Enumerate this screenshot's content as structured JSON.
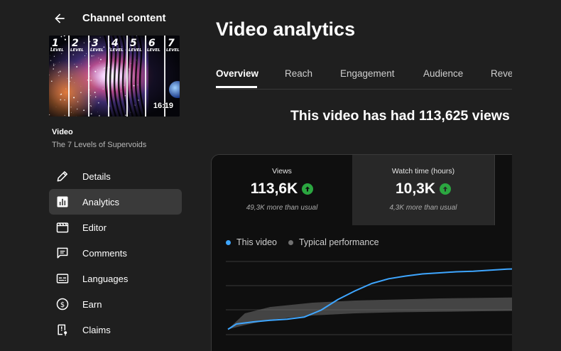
{
  "header": {
    "back_label": "Channel content"
  },
  "video": {
    "thumbnail_levels": [
      "1",
      "2",
      "3",
      "4",
      "5",
      "6",
      "7"
    ],
    "thumbnail_word": "LEVEL",
    "duration": "16:19",
    "label": "Video",
    "title": "The 7 Levels of Supervoids"
  },
  "sidebar": {
    "items": [
      {
        "label": "Details",
        "icon": "pencil-icon"
      },
      {
        "label": "Analytics",
        "icon": "analytics-icon",
        "active": true
      },
      {
        "label": "Editor",
        "icon": "clapperboard-icon"
      },
      {
        "label": "Comments",
        "icon": "comment-icon"
      },
      {
        "label": "Languages",
        "icon": "subtitles-icon"
      },
      {
        "label": "Earn",
        "icon": "dollar-icon"
      },
      {
        "label": "Claims",
        "icon": "copyright-claim-icon"
      }
    ]
  },
  "main": {
    "title": "Video analytics",
    "tabs": [
      "Overview",
      "Reach",
      "Engagement",
      "Audience",
      "Revenue"
    ],
    "headline": "This video has had 113,625 views",
    "metrics": [
      {
        "label": "Views",
        "value": "113,6K",
        "sub": "49,3K more than usual"
      },
      {
        "label": "Watch time (hours)",
        "value": "10,3K",
        "sub": "4,3K more than usual"
      }
    ],
    "legend": [
      {
        "label": "This video",
        "color": "#3ea6ff"
      },
      {
        "label": "Typical performance",
        "color": "#717171"
      }
    ]
  },
  "chart_data": {
    "type": "line",
    "x_ticks": [
      "0",
      "10",
      "20",
      "30"
    ],
    "xlim": [
      0,
      35
    ],
    "series": [
      {
        "name": "This video",
        "color": "#3ea6ff",
        "x": [
          0,
          1,
          3,
          5,
          7,
          9,
          11,
          13,
          15,
          17,
          19,
          21,
          23,
          25,
          27,
          29,
          31,
          33,
          35
        ],
        "y": [
          0.1,
          0.2,
          0.24,
          0.27,
          0.29,
          0.33,
          0.46,
          0.66,
          0.82,
          0.96,
          1.05,
          1.1,
          1.14,
          1.16,
          1.18,
          1.19,
          1.21,
          1.23,
          1.24
        ]
      },
      {
        "name": "Typical performance",
        "color": "#717171",
        "x": [
          0,
          2,
          5,
          10,
          15,
          20,
          25,
          30,
          35
        ],
        "upper": [
          0.1,
          0.4,
          0.52,
          0.6,
          0.64,
          0.66,
          0.68,
          0.69,
          0.7
        ],
        "lower": [
          0.1,
          0.18,
          0.28,
          0.36,
          0.4,
          0.42,
          0.43,
          0.44,
          0.45
        ]
      }
    ]
  }
}
